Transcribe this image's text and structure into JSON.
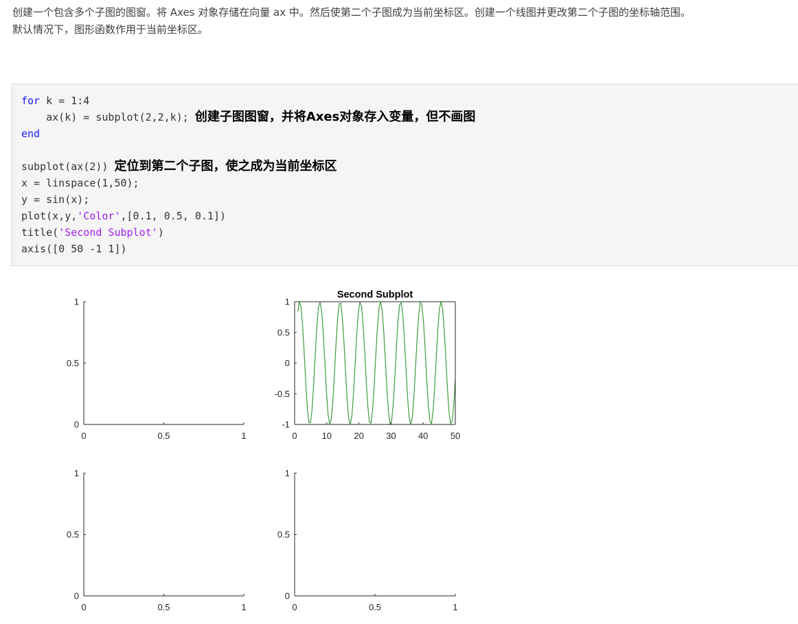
{
  "intro": {
    "line1": "创建一个包含多个子图的图窗。将 Axes 对象存储在向量 ax 中。然后使第二个子图成为当前坐标区。创建一个线图并更改第二个子图的坐标轴范围。",
    "line2": "默认情况下，图形函数作用于当前坐标区。"
  },
  "code": {
    "line1_kw": "for",
    "line1_rest": " k = 1:4",
    "line2_code": "    ax(k) = subplot(2,2,k); ",
    "line2_comment": "创建子图图窗，并将Axes对象存入变量，但不画图",
    "line3_kw": "end",
    "line5_code": "subplot(ax(2)) ",
    "line5_comment": "定位到第二个子图，使之成为当前坐标区",
    "line6": "x = linspace(1,50);",
    "line7": "y = sin(x);",
    "line8_a": "plot(x,y,",
    "line8_str": "'Color'",
    "line8_b": ",[0.1, 0.5, 0.1])",
    "line9_a": "title(",
    "line9_str": "'Second Subplot'",
    "line9_b": ")",
    "line10": "axis([0 50 -1 1])"
  },
  "colors": {
    "keyword": "#1a1aff",
    "string": "#a020f0",
    "line": "#3d9c3d",
    "axis": "#262626"
  },
  "chart_data": [
    {
      "type": "line",
      "title": "",
      "xlim": [
        0,
        1
      ],
      "ylim": [
        0,
        1
      ],
      "x_ticks": [
        "0",
        "0.5",
        "1"
      ],
      "y_ticks": [
        "0",
        "0.5",
        "1"
      ],
      "box": false,
      "series": []
    },
    {
      "type": "line",
      "title": "Second Subplot",
      "xlim": [
        0,
        50
      ],
      "ylim": [
        -1,
        1
      ],
      "x_ticks": [
        "0",
        "10",
        "20",
        "30",
        "40",
        "50"
      ],
      "y_ticks": [
        "-1",
        "-0.5",
        "0",
        "0.5",
        "1"
      ],
      "box": true,
      "series": [
        {
          "function": "sin",
          "x_start": 1,
          "x_end": 50,
          "points": 100,
          "color": "#3d9c3d"
        }
      ]
    },
    {
      "type": "line",
      "title": "",
      "xlim": [
        0,
        1
      ],
      "ylim": [
        0,
        1
      ],
      "x_ticks": [
        "0",
        "0.5",
        "1"
      ],
      "y_ticks": [
        "0",
        "0.5",
        "1"
      ],
      "box": false,
      "series": []
    },
    {
      "type": "line",
      "title": "",
      "xlim": [
        0,
        1
      ],
      "ylim": [
        0,
        1
      ],
      "x_ticks": [
        "0",
        "0.5",
        "1"
      ],
      "y_ticks": [
        "0",
        "0.5",
        "1"
      ],
      "box": false,
      "series": []
    }
  ]
}
